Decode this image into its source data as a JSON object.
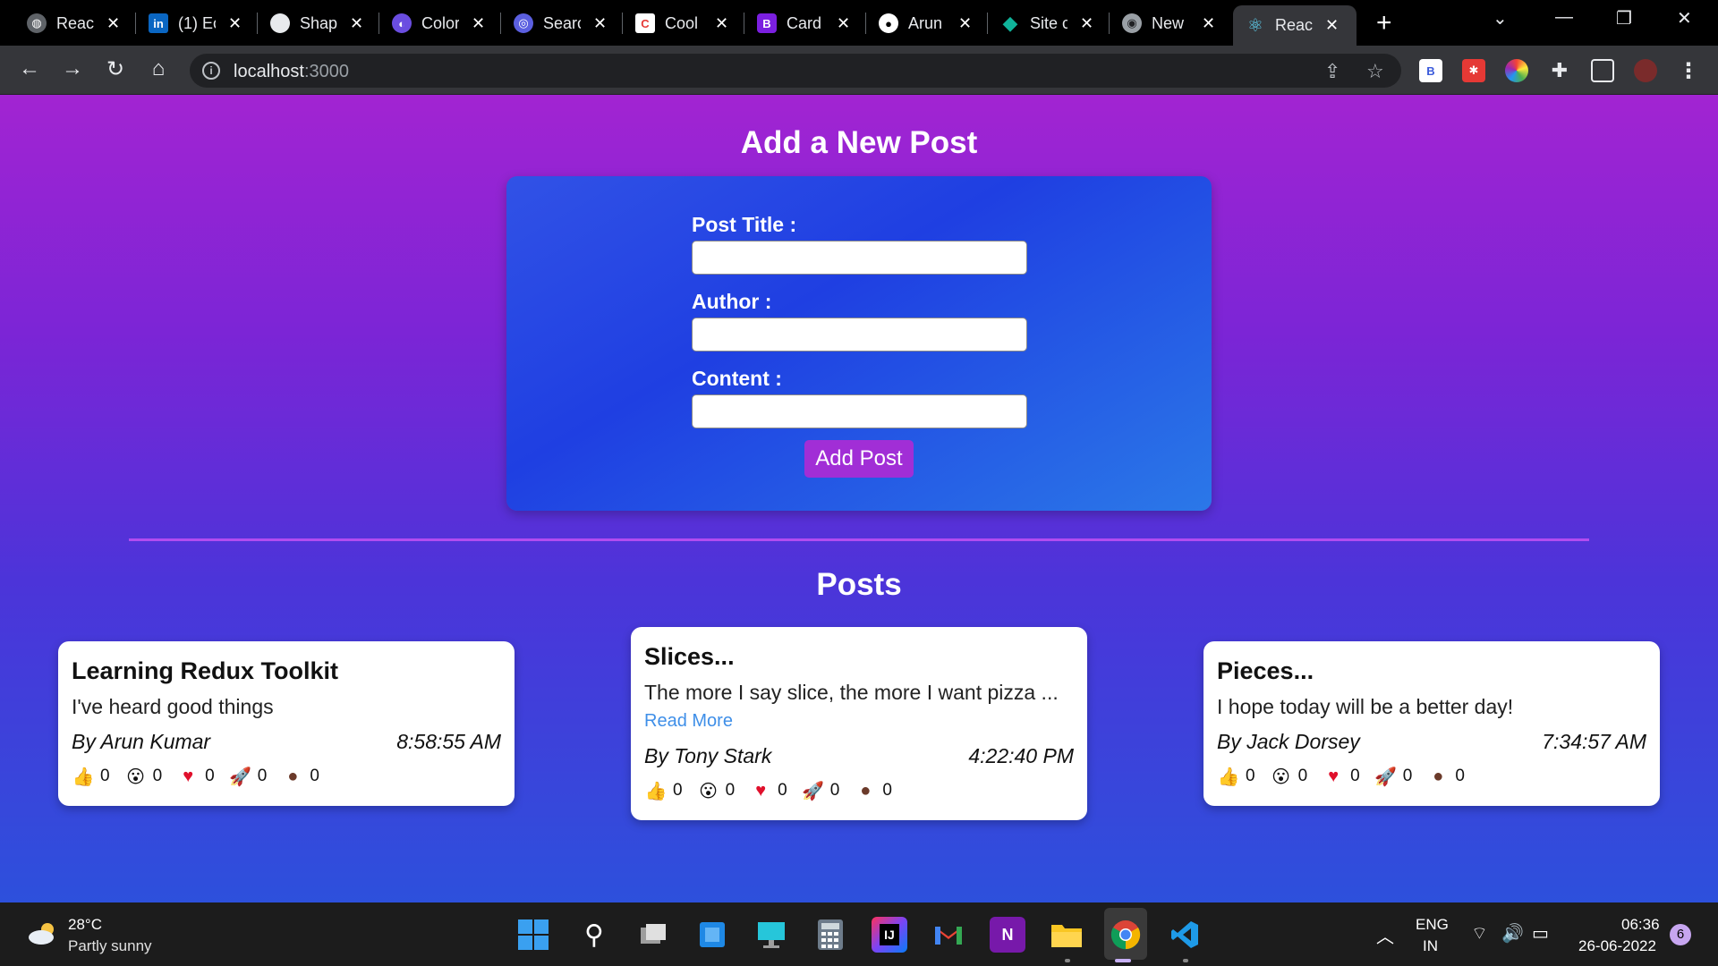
{
  "browser": {
    "tabs": [
      {
        "title": "React",
        "icon": "globe-icon",
        "color": "#5f6368"
      },
      {
        "title": "(1) Ec",
        "icon": "linkedin-icon",
        "color": "#0a66c2"
      },
      {
        "title": "Shap",
        "icon": "shape-icon",
        "color": "#e8eaed"
      },
      {
        "title": "Color",
        "icon": "planet-icon",
        "color": "#6a4de0"
      },
      {
        "title": "Searc",
        "icon": "search-app-icon",
        "color": "#5b5fe0"
      },
      {
        "title": "Cool",
        "icon": "cool-icon",
        "color": "#e53935"
      },
      {
        "title": "Card",
        "icon": "bootstrap-icon",
        "color": "#7b1fe0"
      },
      {
        "title": "Arun",
        "icon": "github-icon",
        "color": "#ffffff"
      },
      {
        "title": "Site c",
        "icon": "diamond-icon",
        "color": "#10b39a"
      },
      {
        "title": "New",
        "icon": "chrome-icon",
        "color": "#9aa0a6"
      },
      {
        "title": "React",
        "icon": "react-icon",
        "color": "#61dafb"
      }
    ],
    "url_host": "localhost",
    "url_port": ":3000"
  },
  "page": {
    "form_heading": "Add a New Post",
    "labels": {
      "title": "Post Title :",
      "author": "Author :",
      "content": "Content :"
    },
    "values": {
      "title": "",
      "author": "",
      "content": ""
    },
    "submit_label": "Add Post",
    "posts_heading": "Posts",
    "posts": [
      {
        "title": "Learning Redux Toolkit",
        "body": "I've heard good things",
        "read_more": "",
        "author": "By Arun Kumar",
        "time": "8:58:55 AM",
        "reactions": {
          "thumbs_up": "0",
          "wow": "0",
          "heart": "0",
          "rocket": "0",
          "coffee": "0"
        }
      },
      {
        "title": "Slices...",
        "body": "The more I say slice, the more I want pizza ...",
        "read_more": "Read More",
        "author": "By Tony Stark",
        "time": "4:22:40 PM",
        "reactions": {
          "thumbs_up": "0",
          "wow": "0",
          "heart": "0",
          "rocket": "0",
          "coffee": "0"
        }
      },
      {
        "title": "Pieces...",
        "body": "I hope today will be a better day!",
        "read_more": "",
        "author": "By Jack Dorsey",
        "time": "7:34:57 AM",
        "reactions": {
          "thumbs_up": "0",
          "wow": "0",
          "heart": "0",
          "rocket": "0",
          "coffee": "0"
        }
      }
    ]
  },
  "taskbar": {
    "weather_temp": "28°C",
    "weather_desc": "Partly sunny",
    "lang_top": "ENG",
    "lang_bottom": "IN",
    "time": "06:36",
    "date": "26-06-2022",
    "notification_count": "6",
    "apps": [
      "start-icon",
      "search-icon",
      "task-view-icon",
      "widgets-icon",
      "remote-desktop-icon",
      "calculator-icon",
      "intellij-icon",
      "gmail-icon",
      "onenote-icon",
      "file-explorer-icon",
      "chrome-icon",
      "vscode-icon"
    ]
  },
  "colors": {
    "accent_button": "#a12ed6",
    "link": "#3f8fe8",
    "divider": "#b34cf0"
  }
}
